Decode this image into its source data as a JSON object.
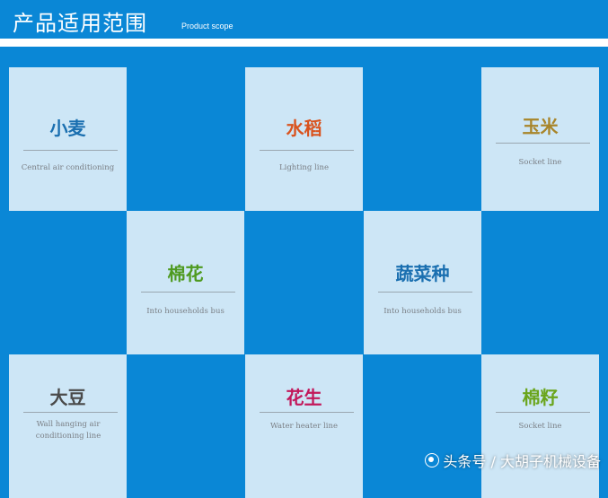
{
  "header": {
    "title": "产品适用范围",
    "subtitle": "Product scope"
  },
  "tiles": [
    {
      "name": "小麦",
      "desc": "Central air conditioning",
      "color": "#1a6fb0"
    },
    {
      "name": "水稻",
      "desc": "Lighting line",
      "color": "#d9531e"
    },
    {
      "name": "玉米",
      "desc": "Socket line",
      "color": "#a8852a"
    },
    {
      "name": "棉花",
      "desc": "Into households bus",
      "color": "#4e9a1f"
    },
    {
      "name": "蔬菜种",
      "desc": "Into households bus",
      "color": "#1a6fb0"
    },
    {
      "name": "大豆",
      "desc": "Wall hanging air conditioning line",
      "color": "#4a4a4a"
    },
    {
      "name": "花生",
      "desc": "Water heater line",
      "color": "#c2185b"
    },
    {
      "name": "棉籽",
      "desc": "Socket line",
      "color": "#6aa51c"
    }
  ],
  "watermark": {
    "text": "头条号 / 大胡子机械设备",
    "icon": "account-icon"
  }
}
